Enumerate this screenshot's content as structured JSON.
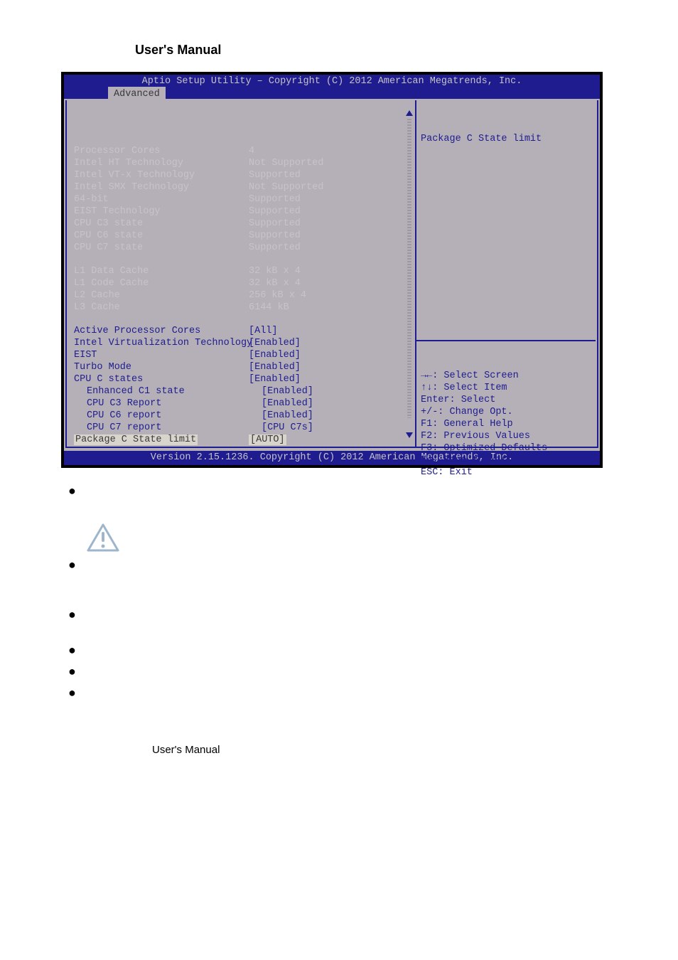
{
  "page": {
    "header_title": "User's Manual",
    "footer_text": "User's Manual"
  },
  "bios": {
    "top_title": "Aptio Setup Utility – Copyright (C) 2012 American Megatrends, Inc.",
    "tab_label": "Advanced",
    "bottom_text": "Version 2.15.1236. Copyright (C) 2012 American Megatrends, Inc.",
    "info_rows": [
      {
        "label": "Processor Cores",
        "value": "4"
      },
      {
        "label": "Intel HT Technology",
        "value": "Not Supported"
      },
      {
        "label": "Intel VT-x Technology",
        "value": "Supported"
      },
      {
        "label": "Intel SMX Technology",
        "value": "Not Supported"
      },
      {
        "label": "64-bit",
        "value": "Supported"
      },
      {
        "label": "EIST Technology",
        "value": "Supported"
      },
      {
        "label": "CPU C3 state",
        "value": "Supported"
      },
      {
        "label": "CPU C6 state",
        "value": "Supported"
      },
      {
        "label": "CPU C7 state",
        "value": "Supported"
      }
    ],
    "cache_rows": [
      {
        "label": "L1 Data Cache",
        "value": "32 kB x 4"
      },
      {
        "label": "L1 Code Cache",
        "value": "32 kB x 4"
      },
      {
        "label": "L2 Cache",
        "value": "256 kB x 4"
      },
      {
        "label": "L3 Cache",
        "value": "6144 kB"
      }
    ],
    "setting_rows": [
      {
        "label": "Active Processor Cores",
        "value": "[All]",
        "indent": false
      },
      {
        "label": "Intel Virtualization Technology",
        "value": "[Enabled]",
        "indent": false
      },
      {
        "label": "EIST",
        "value": "[Enabled]",
        "indent": false
      },
      {
        "label": "Turbo Mode",
        "value": "[Enabled]",
        "indent": false
      },
      {
        "label": "CPU C states",
        "value": "[Enabled]",
        "indent": false
      },
      {
        "label": "Enhanced C1 state",
        "value": "[Enabled]",
        "indent": true
      },
      {
        "label": "CPU C3 Report",
        "value": "[Enabled]",
        "indent": true
      },
      {
        "label": "CPU C6 report",
        "value": "[Enabled]",
        "indent": true
      },
      {
        "label": "CPU C7 report",
        "value": "[CPU C7s]",
        "indent": true
      }
    ],
    "selected_row": {
      "label": "Package C State limit",
      "value": "[AUTO]"
    },
    "help_title": "Package C State limit",
    "keys": [
      "→←: Select Screen",
      "↑↓: Select Item",
      "Enter: Select",
      "+/-: Change Opt.",
      "F1: General Help",
      "F2: Previous Values",
      "F3: Optimized Defaults",
      "F4: Save & Exit",
      "ESC: Exit"
    ]
  },
  "doc_items": [
    {
      "title": "",
      "body": ""
    },
    {
      "title": "",
      "body": ""
    },
    {
      "title": "",
      "body": ""
    },
    {
      "title": "",
      "body": ""
    },
    {
      "title": "",
      "body": ""
    },
    {
      "title": "",
      "body": ""
    }
  ]
}
